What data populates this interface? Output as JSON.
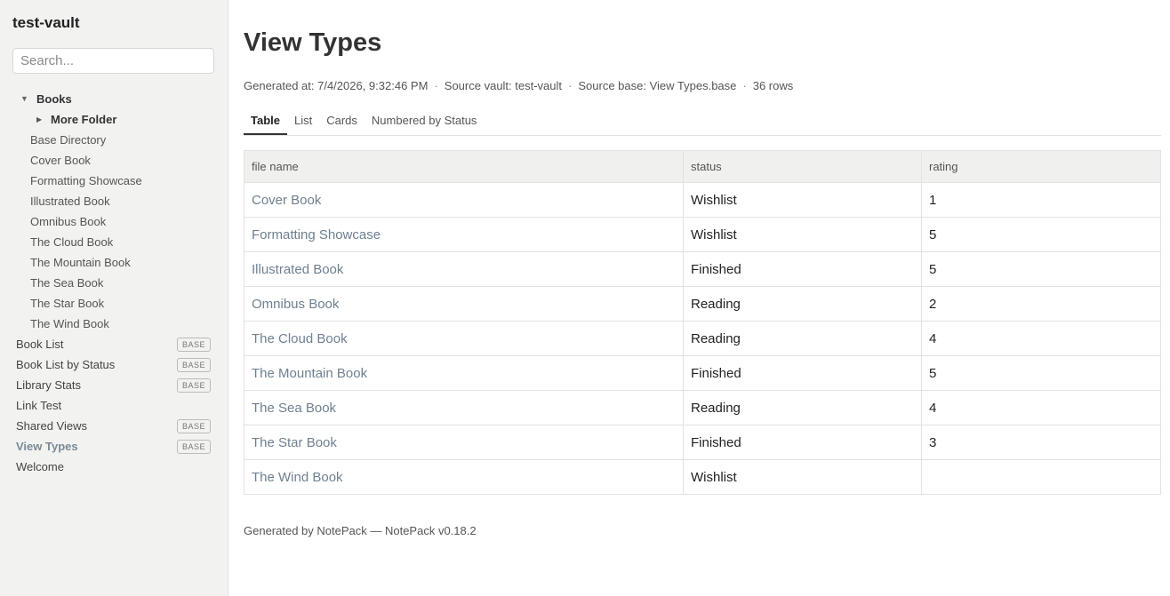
{
  "sidebar": {
    "vault_title": "test-vault",
    "search_placeholder": "Search...",
    "folders": {
      "books": {
        "label": "Books",
        "arrow": "▼"
      },
      "more_folder": {
        "label": "More Folder",
        "arrow": "▶"
      }
    },
    "nested_files": [
      "Base Directory",
      "Cover Book",
      "Formatting Showcase",
      "Illustrated Book",
      "Omnibus Book",
      "The Cloud Book",
      "The Mountain Book",
      "The Sea Book",
      "The Star Book",
      "The Wind Book"
    ],
    "top_files": [
      {
        "label": "Book List",
        "badge": "BASE"
      },
      {
        "label": "Book List by Status",
        "badge": "BASE"
      },
      {
        "label": "Library Stats",
        "badge": "BASE"
      },
      {
        "label": "Link Test",
        "badge": ""
      },
      {
        "label": "Shared Views",
        "badge": "BASE"
      },
      {
        "label": "View Types",
        "badge": "BASE",
        "active": true
      },
      {
        "label": "Welcome",
        "badge": ""
      }
    ]
  },
  "main": {
    "title": "View Types",
    "meta": {
      "generated": "Generated at: 7/4/2026, 9:32:46 PM",
      "vault": "Source vault: test-vault",
      "base": "Source base: View Types.base",
      "rows": "36 rows",
      "separator": "·"
    },
    "tabs": [
      "Table",
      "List",
      "Cards",
      "Numbered by Status"
    ],
    "active_tab": "Table",
    "table": {
      "headers": [
        "file name",
        "status",
        "rating"
      ],
      "rows": [
        [
          "Cover Book",
          "Wishlist",
          "1"
        ],
        [
          "Formatting Showcase",
          "Wishlist",
          "5"
        ],
        [
          "Illustrated Book",
          "Finished",
          "5"
        ],
        [
          "Omnibus Book",
          "Reading",
          "2"
        ],
        [
          "The Cloud Book",
          "Reading",
          "4"
        ],
        [
          "The Mountain Book",
          "Finished",
          "5"
        ],
        [
          "The Sea Book",
          "Reading",
          "4"
        ],
        [
          "The Star Book",
          "Finished",
          "3"
        ],
        [
          "The Wind Book",
          "Wishlist",
          ""
        ]
      ]
    },
    "footer": "Generated by NotePack — NotePack v0.18.2"
  },
  "colors": {
    "sidebar_bg": "#f2f2f1",
    "link": "#6f8090",
    "active_nav": "#7a8a96",
    "header_bg": "#f0f0ef"
  }
}
